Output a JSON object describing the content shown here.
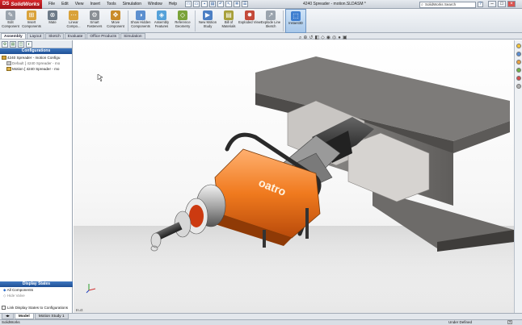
{
  "app": {
    "name": "SolidWorks",
    "brand_prefix": "DS",
    "doc_title": "4240 Spreader - motion.SLDASM *"
  },
  "menu": [
    "File",
    "Edit",
    "View",
    "Insert",
    "Tools",
    "Simulation",
    "Window",
    "Help"
  ],
  "search": {
    "placeholder": "SolidWorks Search"
  },
  "ribbon": [
    {
      "label": "Edit Component",
      "icon": "edit-component-icon",
      "color": "#9aa3ad"
    },
    {
      "label": "Insert Components",
      "icon": "insert-components-icon",
      "color": "#d9a23a"
    },
    {
      "label": "Mate",
      "icon": "mate-icon",
      "color": "#6d7a88"
    },
    {
      "label": "Linear Compo...",
      "icon": "linear-pattern-icon",
      "color": "#d9a23a"
    },
    {
      "label": "Smart Fasteners",
      "icon": "smart-fasteners-icon",
      "color": "#8a8f95"
    },
    {
      "label": "Move Component",
      "icon": "move-component-icon",
      "color": "#c98b2a"
    },
    {
      "label": "Show Hidden Components",
      "icon": "show-hidden-icon",
      "color": "#5c8fcf"
    },
    {
      "label": "Assembly Features",
      "icon": "assembly-features-icon",
      "color": "#55a1d9"
    },
    {
      "label": "Reference Geometry",
      "icon": "reference-geometry-icon",
      "color": "#7aa33a"
    },
    {
      "label": "New Motion Study",
      "icon": "new-motion-study-icon",
      "color": "#4c7fc4"
    },
    {
      "label": "Bill of Materials",
      "icon": "bill-of-materials-icon",
      "color": "#a8a03a"
    },
    {
      "label": "Exploded View",
      "icon": "exploded-view-icon",
      "color": "#c44a3a"
    },
    {
      "label": "Explode Line Sketch",
      "icon": "explode-line-sketch-icon",
      "color": "#9aa3ad"
    },
    {
      "label": "Instant3D",
      "icon": "instant3d-icon",
      "color": "#3f7fd0"
    }
  ],
  "tabs": [
    "Assembly",
    "Layout",
    "Sketch",
    "Evaluate",
    "Office Products",
    "Simulation"
  ],
  "left": {
    "configurations_header": "Configurations",
    "tree": [
      "4240 Spreader - motion Configu",
      "Default [ 4240 Spreader - mo",
      "Motion [ 4240 Spreader - mo"
    ],
    "display_states_header": "Display States",
    "display_states": [
      "All Components",
      "Hide Valve"
    ],
    "link_label": "Link Display States to Configurations"
  },
  "viewport": {
    "unit_label": "In.ct"
  },
  "bottom_tabs": [
    "Model",
    "Motion Study 1"
  ],
  "status": {
    "left": "SolidWorks",
    "right": "Under Defined",
    "help": "?"
  }
}
